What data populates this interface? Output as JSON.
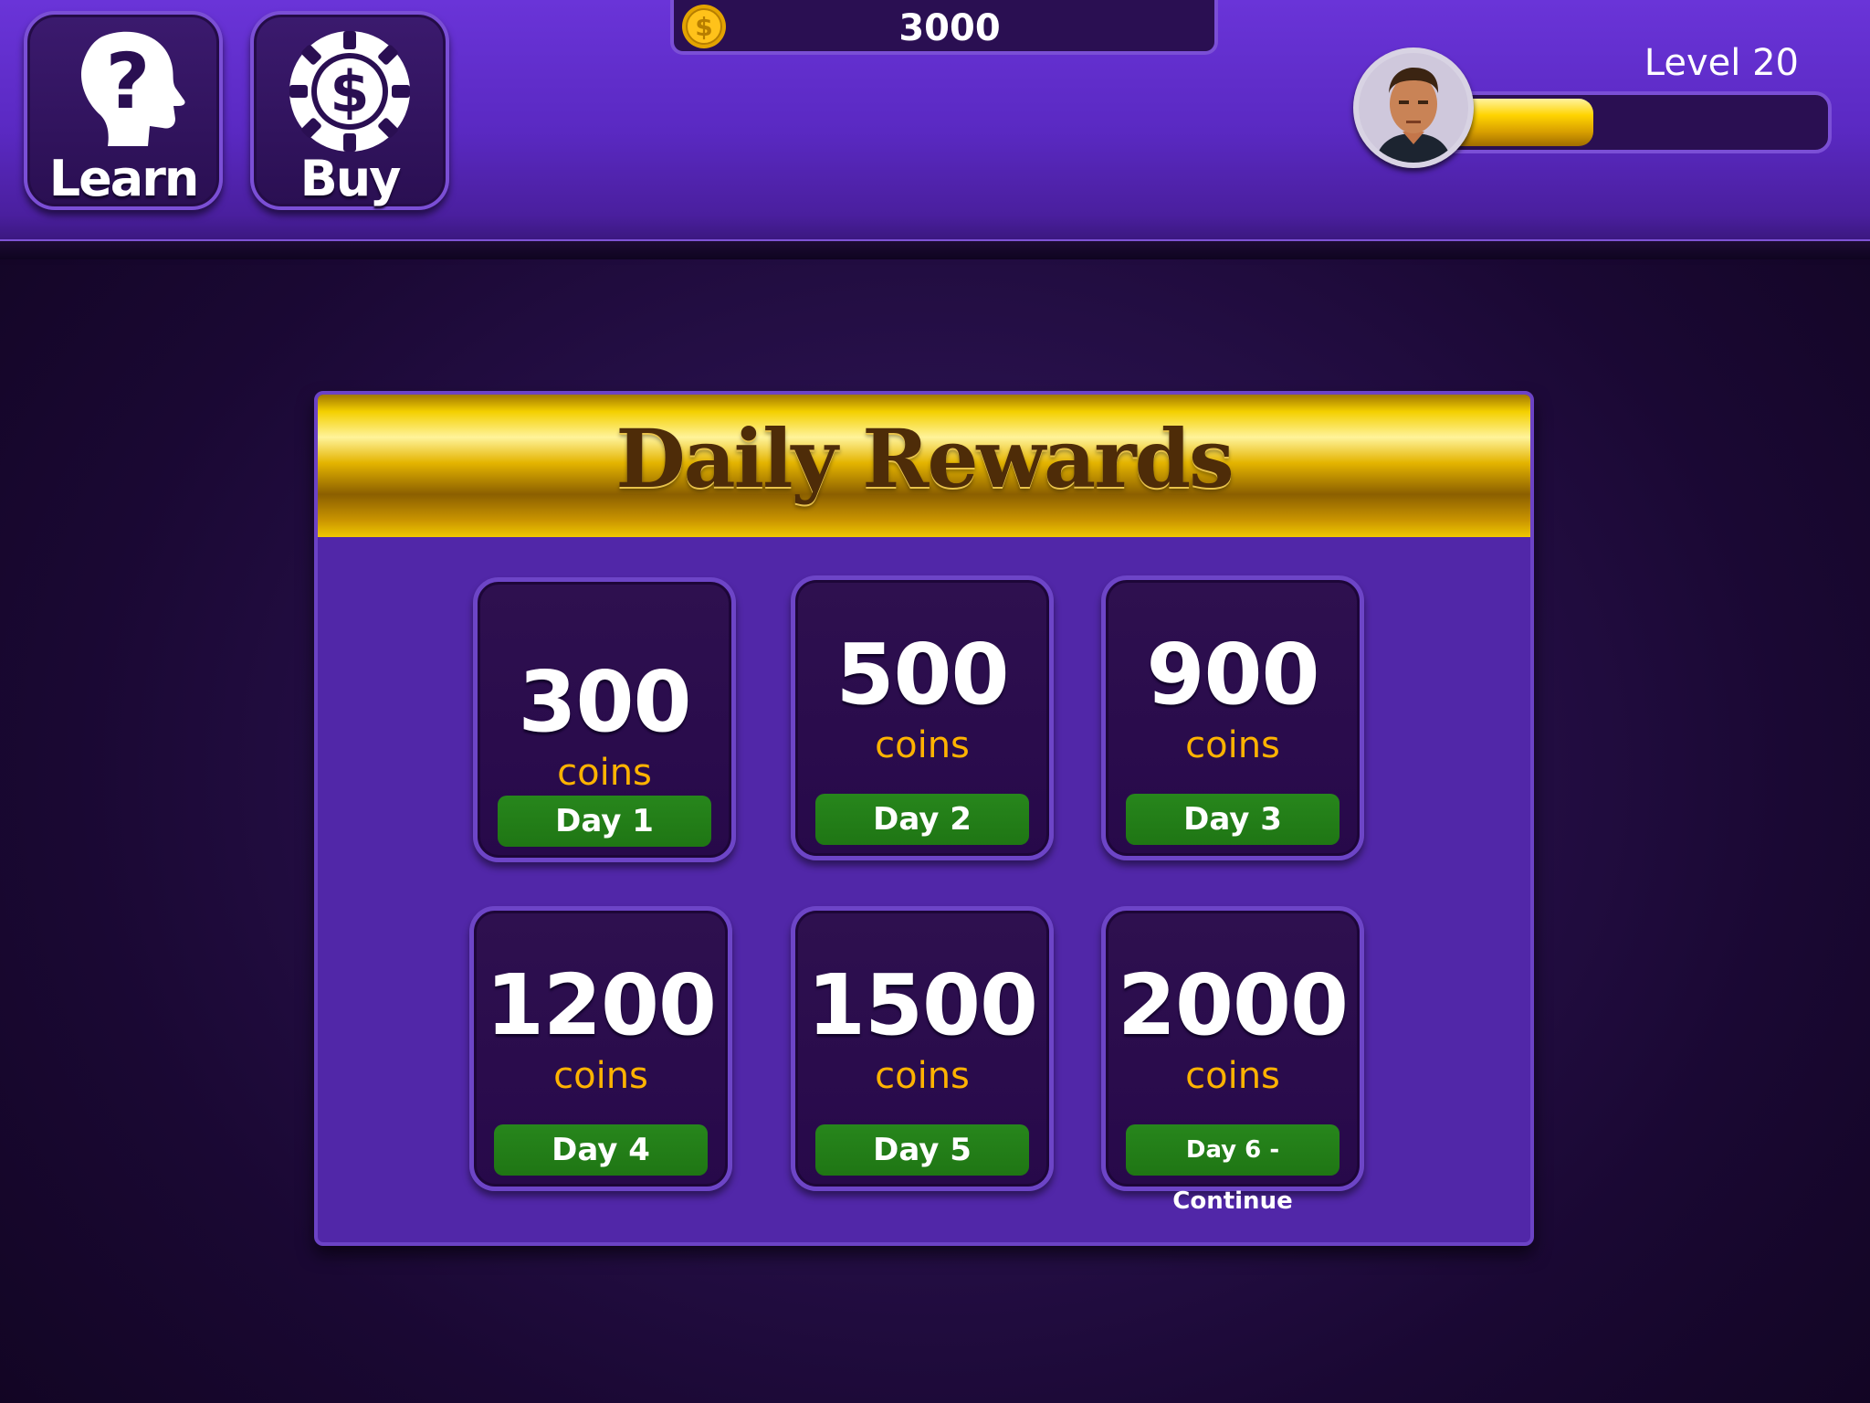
{
  "header": {
    "learn_label": "Learn",
    "buy_label": "Buy",
    "coin_balance": "3000",
    "level_label": "Level 20",
    "xp_progress": 0.37,
    "colors": {
      "bar": "#5a29c2",
      "accent_gold": "#ffd400",
      "button_bg": "#2a0f52"
    },
    "icons": {
      "learn": "question-head-icon",
      "buy": "poker-chip-dollar-icon",
      "balance": "gold-coin-icon",
      "avatar": "player-avatar"
    }
  },
  "daily_rewards": {
    "title": "Daily Rewards",
    "rewards": [
      {
        "amount": "300",
        "unit": "coins",
        "day": "Day 1"
      },
      {
        "amount": "500",
        "unit": "coins",
        "day": "Day 2"
      },
      {
        "amount": "900",
        "unit": "coins",
        "day": "Day 3"
      },
      {
        "amount": "1200",
        "unit": "coins",
        "day": "Day 4"
      },
      {
        "amount": "1500",
        "unit": "coins",
        "day": "Day 5"
      },
      {
        "amount": "2000",
        "unit": "coins",
        "day": "Day 6 - Continue"
      }
    ],
    "colors": {
      "panel": "#5127a8",
      "card": "#2e104f",
      "coins_text": "#ffb300",
      "day_button": "#1f7614"
    }
  }
}
